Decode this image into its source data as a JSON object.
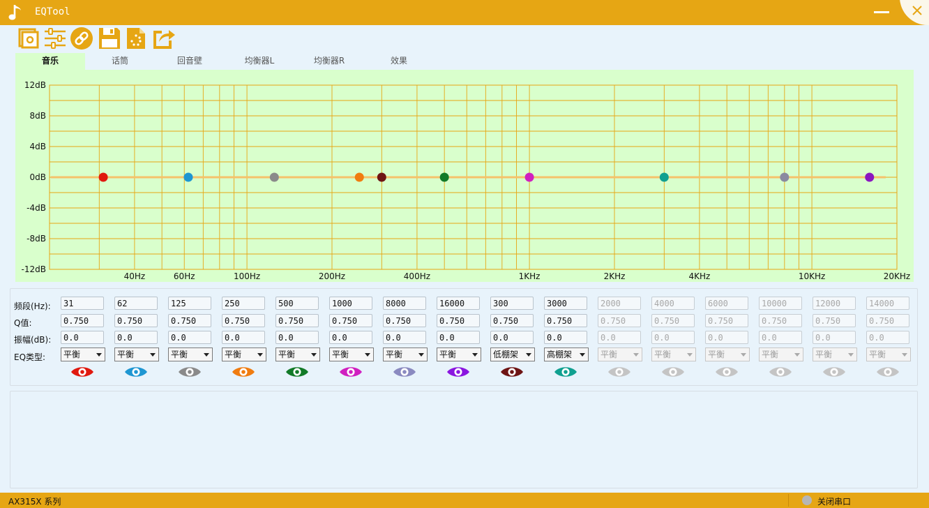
{
  "window": {
    "title": "EQTool"
  },
  "toolbar": {
    "items": [
      "settings-icon",
      "sliders-icon",
      "link-icon",
      "save-icon",
      "load-icon",
      "export-icon"
    ]
  },
  "tabs": [
    {
      "label": "音乐",
      "active": true
    },
    {
      "label": "话筒",
      "active": false
    },
    {
      "label": "回音壁",
      "active": false
    },
    {
      "label": "均衡器L",
      "active": false
    },
    {
      "label": "均衡器R",
      "active": false
    },
    {
      "label": "效果",
      "active": false
    }
  ],
  "chart_data": {
    "type": "line",
    "x_scale": "log",
    "xlim": [
      20,
      20000
    ],
    "ylim": [
      -12,
      12
    ],
    "grid": true,
    "y_ticks": [
      "12dB",
      "8dB",
      "4dB",
      "0dB",
      "-4dB",
      "-8dB",
      "-12dB"
    ],
    "x_tick_labels": [
      {
        "hz": 40,
        "label": "40Hz"
      },
      {
        "hz": 60,
        "label": "60Hz"
      },
      {
        "hz": 100,
        "label": "100Hz"
      },
      {
        "hz": 200,
        "label": "200Hz"
      },
      {
        "hz": 400,
        "label": "400Hz"
      },
      {
        "hz": 1000,
        "label": "1KHz"
      },
      {
        "hz": 2000,
        "label": "2KHz"
      },
      {
        "hz": 4000,
        "label": "4KHz"
      },
      {
        "hz": 10000,
        "label": "10KHz"
      },
      {
        "hz": 20000,
        "label": "20KHz"
      }
    ],
    "curve": {
      "color": "#f5c26b",
      "gain_db": 0
    },
    "points": [
      {
        "hz": 31,
        "db": 0,
        "color": "#e0190f"
      },
      {
        "hz": 62,
        "db": 0,
        "color": "#1e96d2"
      },
      {
        "hz": 125,
        "db": 0,
        "color": "#8a8a8a"
      },
      {
        "hz": 250,
        "db": 0,
        "color": "#f07c10"
      },
      {
        "hz": 300,
        "db": 0,
        "color": "#6e1414"
      },
      {
        "hz": 500,
        "db": 0,
        "color": "#127a28"
      },
      {
        "hz": 1000,
        "db": 0,
        "color": "#d020c0"
      },
      {
        "hz": 3000,
        "db": 0,
        "color": "#10a090"
      },
      {
        "hz": 8000,
        "db": 0,
        "color": "#8a8aa0"
      },
      {
        "hz": 16000,
        "db": 0,
        "color": "#8a16c0"
      }
    ]
  },
  "params": {
    "labels": {
      "freq": "频段(Hz):",
      "q": "Q值:",
      "gain": "振幅(dB):",
      "type": "EQ类型:"
    },
    "bands": [
      {
        "freq": "31",
        "q": "0.750",
        "gain": "0.0",
        "type": "平衡",
        "eye_color": "#e0190f",
        "enabled": true
      },
      {
        "freq": "62",
        "q": "0.750",
        "gain": "0.0",
        "type": "平衡",
        "eye_color": "#1e96d2",
        "enabled": true
      },
      {
        "freq": "125",
        "q": "0.750",
        "gain": "0.0",
        "type": "平衡",
        "eye_color": "#8a8a8a",
        "enabled": true
      },
      {
        "freq": "250",
        "q": "0.750",
        "gain": "0.0",
        "type": "平衡",
        "eye_color": "#f07c10",
        "enabled": true
      },
      {
        "freq": "500",
        "q": "0.750",
        "gain": "0.0",
        "type": "平衡",
        "eye_color": "#127a28",
        "enabled": true
      },
      {
        "freq": "1000",
        "q": "0.750",
        "gain": "0.0",
        "type": "平衡",
        "eye_color": "#d020c0",
        "enabled": true
      },
      {
        "freq": "8000",
        "q": "0.750",
        "gain": "0.0",
        "type": "平衡",
        "eye_color": "#8a8ac0",
        "enabled": true
      },
      {
        "freq": "16000",
        "q": "0.750",
        "gain": "0.0",
        "type": "平衡",
        "eye_color": "#8a16e0",
        "enabled": true
      },
      {
        "freq": "300",
        "q": "0.750",
        "gain": "0.0",
        "type": "低棚架",
        "eye_color": "#6e1414",
        "enabled": true
      },
      {
        "freq": "3000",
        "q": "0.750",
        "gain": "0.0",
        "type": "高棚架",
        "eye_color": "#10a090",
        "enabled": true
      },
      {
        "freq": "2000",
        "q": "0.750",
        "gain": "0.0",
        "type": "平衡",
        "eye_color": "#c4c4c4",
        "enabled": false
      },
      {
        "freq": "4000",
        "q": "0.750",
        "gain": "0.0",
        "type": "平衡",
        "eye_color": "#c4c4c4",
        "enabled": false
      },
      {
        "freq": "6000",
        "q": "0.750",
        "gain": "0.0",
        "type": "平衡",
        "eye_color": "#c4c4c4",
        "enabled": false
      },
      {
        "freq": "10000",
        "q": "0.750",
        "gain": "0.0",
        "type": "平衡",
        "eye_color": "#c4c4c4",
        "enabled": false
      },
      {
        "freq": "12000",
        "q": "0.750",
        "gain": "0.0",
        "type": "平衡",
        "eye_color": "#c4c4c4",
        "enabled": false
      },
      {
        "freq": "14000",
        "q": "0.750",
        "gain": "0.0",
        "type": "平衡",
        "eye_color": "#c4c4c4",
        "enabled": false
      }
    ]
  },
  "status": {
    "series": "AX315X 系列",
    "port": "关闭串口",
    "port_led_color": "#b6b6b6"
  },
  "colors": {
    "accent": "#e6a614",
    "chart_bg": "#d9ffcc",
    "grid": "#e6a614",
    "background": "#e8f3fb"
  }
}
